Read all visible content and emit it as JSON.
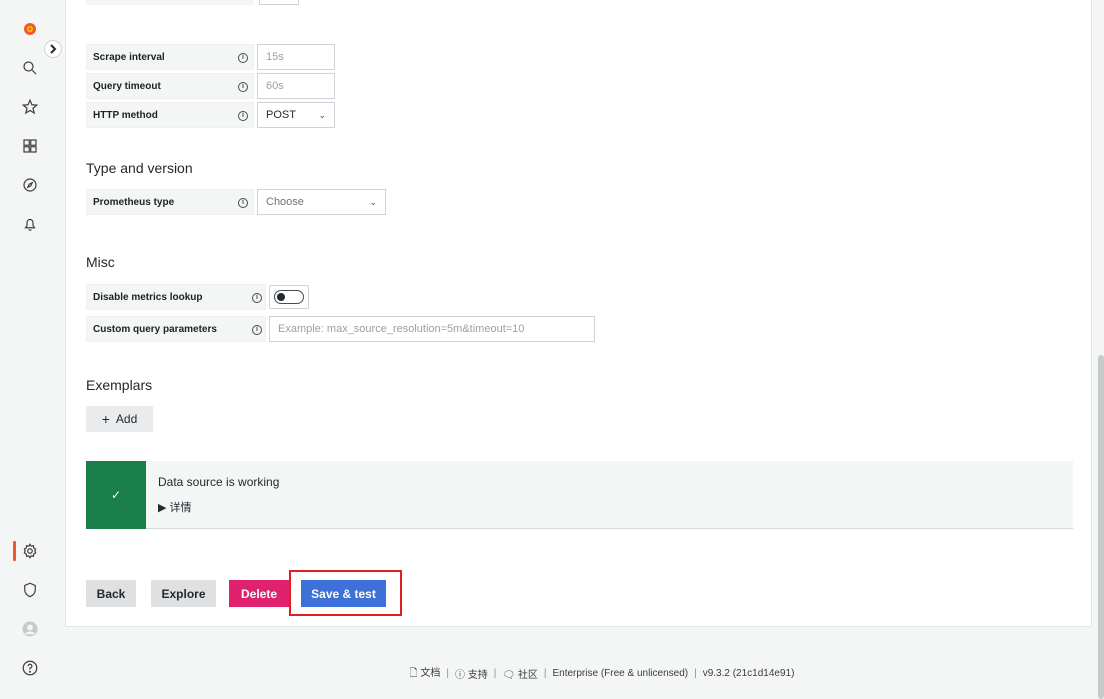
{
  "fields": {
    "scrape_interval": {
      "label": "Scrape interval",
      "placeholder": "15s"
    },
    "query_timeout": {
      "label": "Query timeout",
      "placeholder": "60s"
    },
    "http_method": {
      "label": "HTTP method",
      "value": "POST"
    }
  },
  "type_version": {
    "title": "Type and version",
    "prometheus_type": {
      "label": "Prometheus type",
      "value": "Choose"
    }
  },
  "misc": {
    "title": "Misc",
    "disable_metrics_lookup": {
      "label": "Disable metrics lookup",
      "enabled": false
    },
    "custom_query_parameters": {
      "label": "Custom query parameters",
      "placeholder": "Example: max_source_resolution=5m&timeout=10"
    }
  },
  "exemplars": {
    "title": "Exemplars",
    "add_label": "Add"
  },
  "alert": {
    "title": "Data source is working",
    "details": "▶ 详情",
    "status_color": "#1a7f4b"
  },
  "actions": {
    "back": "Back",
    "explore": "Explore",
    "delete": "Delete",
    "save_test": "Save & test"
  },
  "footer": {
    "docs": "文档",
    "support": "支持",
    "community": "社区",
    "edition": "Enterprise (Free & unlicensed)",
    "version": "v9.3.2 (21c1d14e91)"
  },
  "icons": [
    "grafana-logo-icon",
    "expand-chevron-icon",
    "search-icon",
    "star-icon",
    "dashboards-icon",
    "explore-icon",
    "alerting-icon",
    "configuration-gear-icon",
    "shield-icon",
    "user-avatar-icon",
    "help-icon"
  ],
  "colors": {
    "brand": "#f05a28",
    "primary": "#3d71d9",
    "danger": "#e0226e",
    "success": "#1a7f4b",
    "highlight": "#e02020"
  }
}
